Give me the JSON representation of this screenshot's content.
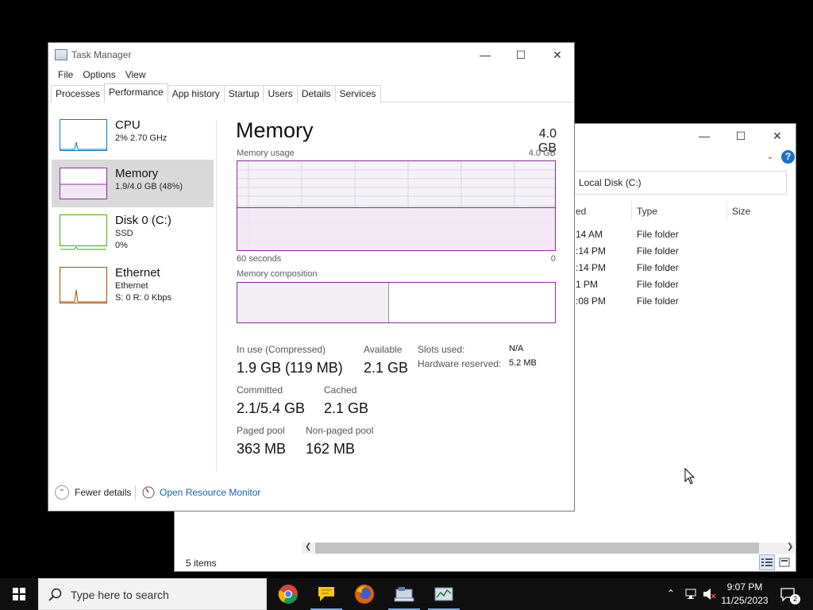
{
  "explorer": {
    "address": "Local Disk (C:)",
    "columns": [
      "ed",
      "Type",
      "Size"
    ],
    "rows": [
      {
        "modified": "14 AM",
        "type": "File folder"
      },
      {
        "modified": ":14 PM",
        "type": "File folder"
      },
      {
        "modified": ":14 PM",
        "type": "File folder"
      },
      {
        "modified": "1 PM",
        "type": "File folder"
      },
      {
        "modified": ":08 PM",
        "type": "File folder"
      }
    ],
    "status": "5 items",
    "help_label": "?"
  },
  "taskmanager": {
    "title": "Task Manager",
    "menu": [
      "File",
      "Options",
      "View"
    ],
    "tabs": [
      "Processes",
      "Performance",
      "App history",
      "Startup",
      "Users",
      "Details",
      "Services"
    ],
    "active_tab": "Performance",
    "sidebar": [
      {
        "label": "CPU",
        "sub1": "2%  2.70 GHz",
        "sub2": "",
        "color": "#117dbb"
      },
      {
        "label": "Memory",
        "sub1": "1.9/4.0 GB (48%)",
        "sub2": "",
        "color": "#8b2b9a"
      },
      {
        "label": "Disk 0 (C:)",
        "sub1": "SSD",
        "sub2": "0%",
        "color": "#4da60c"
      },
      {
        "label": "Ethernet",
        "sub1": "Ethernet",
        "sub2": "S: 0 R: 0 Kbps",
        "color": "#a74f01"
      }
    ],
    "memory": {
      "title": "Memory",
      "total": "4.0 GB",
      "usage_label": "Memory usage",
      "usage_max": "4.0 GB",
      "time_left": "60 seconds",
      "time_right": "0",
      "composition_label": "Memory composition",
      "usage_fraction": 0.48,
      "stats": {
        "in_use_label": "In use (Compressed)",
        "in_use_value": "1.9 GB (119 MB)",
        "available_label": "Available",
        "available_value": "2.1 GB",
        "slots_label": "Slots used:",
        "slots_value": "N/A",
        "hw_reserved_label": "Hardware reserved:",
        "hw_reserved_value": "5.2 MB",
        "committed_label": "Committed",
        "committed_value": "2.1/5.4 GB",
        "cached_label": "Cached",
        "cached_value": "2.1 GB",
        "paged_label": "Paged pool",
        "paged_value": "363 MB",
        "nonpaged_label": "Non-paged pool",
        "nonpaged_value": "162 MB"
      }
    },
    "footer": {
      "fewer_details": "Fewer details",
      "resource_monitor": "Open Resource Monitor"
    }
  },
  "taskbar": {
    "search_placeholder": "Type here to search",
    "time": "9:07 PM",
    "date": "11/25/2023",
    "notifications": "2",
    "apps": [
      "chrome-icon",
      "notes-icon",
      "firefox-icon",
      "file-manager-icon",
      "task-manager-icon"
    ]
  }
}
